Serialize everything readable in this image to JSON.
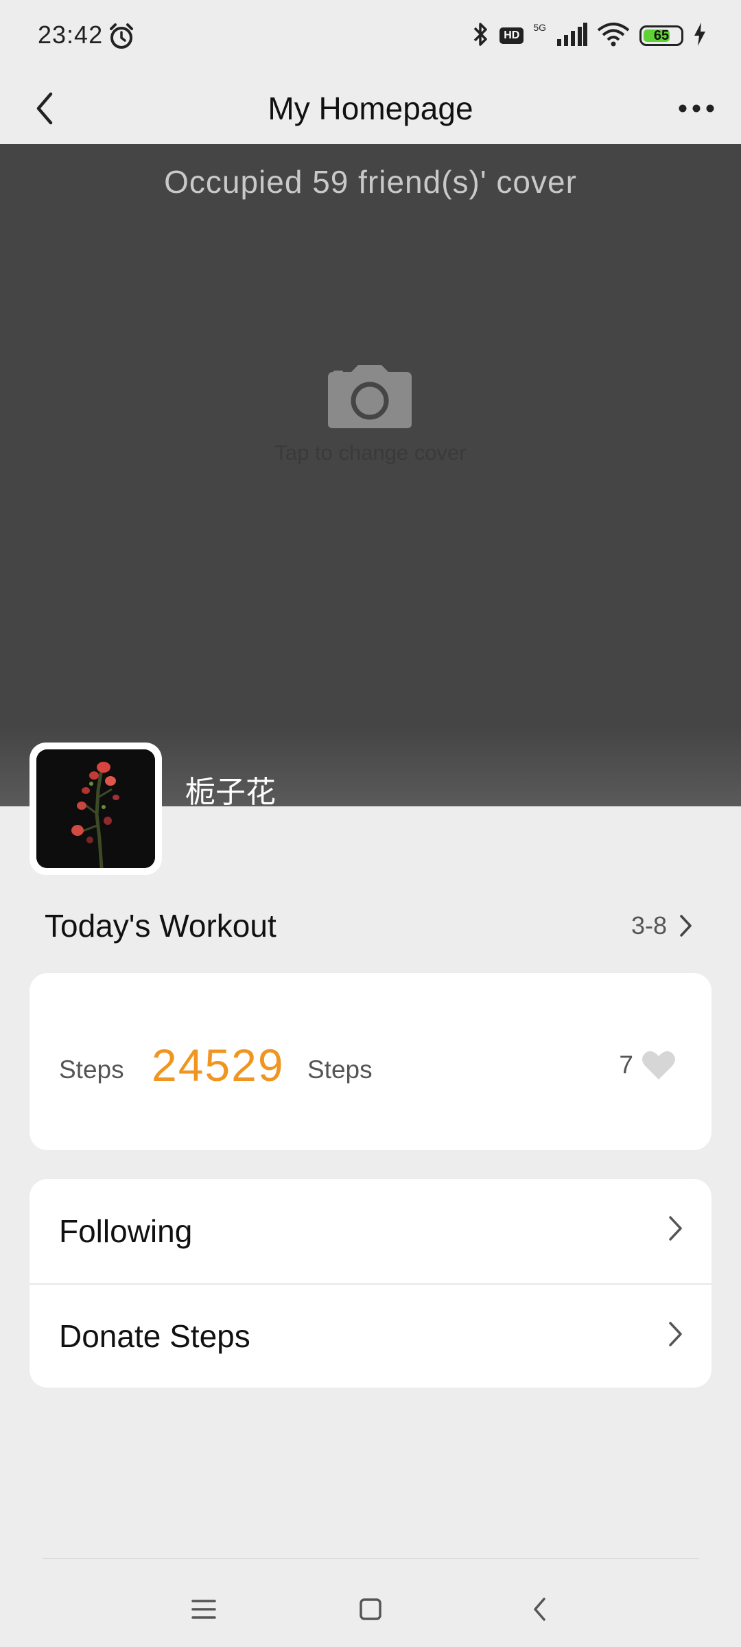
{
  "status_bar": {
    "time": "23:42",
    "network_label": "5G",
    "hd_label": "HD",
    "battery_level": "65",
    "battery_fraction": 0.65
  },
  "header": {
    "title": "My Homepage",
    "back_icon": "chevron-left-icon",
    "more_icon": "more-dots-icon"
  },
  "cover": {
    "occupied_text": "Occupied 59 friend(s)' cover",
    "hint": "Tap to change cover",
    "icon": "camera-icon"
  },
  "profile": {
    "name": "栀子花"
  },
  "workout": {
    "section_title": "Today's Workout",
    "date": "3-8",
    "steps_label_left": "Steps",
    "steps_count": "24529",
    "steps_label_right": "Steps",
    "likes": "7"
  },
  "menu": {
    "items": [
      {
        "label": "Following"
      },
      {
        "label": "Donate Steps"
      }
    ]
  },
  "colors": {
    "accent_orange": "#f0951f",
    "cover_bg": "#454545",
    "page_bg": "#ededed",
    "battery_green": "#5fd235"
  }
}
